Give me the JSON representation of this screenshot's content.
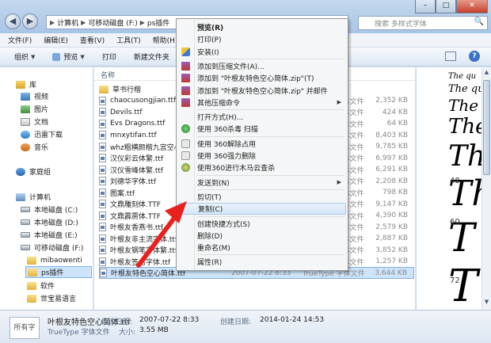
{
  "address": {
    "segments": [
      "计算机",
      "可移动磁盘 (F:)",
      "ps插件"
    ],
    "search_placeholder": "搜索 多样式字体"
  },
  "menubar": [
    "文件(F)",
    "编辑(E)",
    "查看(V)",
    "工具(T)",
    "帮助(H)"
  ],
  "toolbar": {
    "organize": "组织",
    "preview": "预览",
    "print": "打印",
    "new_folder": "新建文件夹"
  },
  "sidebar": {
    "library": "库",
    "video": "视频",
    "pictures": "图片",
    "documents": "文档",
    "thunder": "迅雷下载",
    "music": "音乐",
    "homegroup": "家庭组",
    "computer": "计算机",
    "drive_c": "本地磁盘 (C:)",
    "drive_d": "本地磁盘 (D:)",
    "drive_e": "本地磁盘 (E:)",
    "drive_f": "可移动磁盘 (F:)",
    "folder_mibao": "mibaowenti",
    "folder_ps": "ps插件",
    "folder_software": "软件",
    "folder_shibao": "世宝易语言"
  },
  "filelist": {
    "col_name": "名称",
    "rows": [
      {
        "name": "草书行楷",
        "date": "",
        "type": "",
        "size": ""
      },
      {
        "name": "chaocusongjian.ttf",
        "date": "",
        "type": "TrueType 字体文件",
        "size": "2,352 KB"
      },
      {
        "name": "Devils.ttf",
        "date": "",
        "type": "TrueType 字体文件",
        "size": "424 KB"
      },
      {
        "name": "Evs Dragons.ttf",
        "date": "",
        "type": "TrueType 字体文件",
        "size": "64 KB"
      },
      {
        "name": "mnxytifan.ttf",
        "date": "",
        "type": "TrueType 字体文件",
        "size": "8,403 KB"
      },
      {
        "name": "whz粗横颜楷九宫空心.ttf",
        "date": "",
        "type": "TrueType 字体文件",
        "size": "9,785 KB"
      },
      {
        "name": "汉仪彩云体繁.ttf",
        "date": "",
        "type": "TrueType 字体文件",
        "size": "6,997 KB"
      },
      {
        "name": "汉仪雪峰体繁.ttf",
        "date": "",
        "type": "TrueType 字体文件",
        "size": "6,291 KB"
      },
      {
        "name": "刘德华字体.ttf",
        "date": "",
        "type": "TrueType 字体文件",
        "size": "2,208 KB"
      },
      {
        "name": "图案.ttf",
        "date": "",
        "type": "TrueType 字体文件",
        "size": "798 KB"
      },
      {
        "name": "文鼎雕刻体.TTF",
        "date": "",
        "type": "TrueType 字体文件",
        "size": "9,147 KB"
      },
      {
        "name": "文鼎霹雳体.TTF",
        "date": "",
        "type": "TrueType 字体文件",
        "size": "4,390 KB"
      },
      {
        "name": "叶根友香燕书.ttf",
        "date": "",
        "type": "TrueType 字体文件",
        "size": "2,579 KB"
      },
      {
        "name": "叶根友非主流字体.ttf",
        "date": "",
        "type": "TrueType 字体文件",
        "size": "2,887 KB"
      },
      {
        "name": "叶根友钢笔字体繁.ttf",
        "date": "",
        "type": "TrueType 字体文件",
        "size": "3,852 KB"
      },
      {
        "name": "叶根友签名字体.ttf",
        "date": "",
        "type": "TrueType 字体文件",
        "size": "1,257 KB"
      },
      {
        "name": "叶根友特色空心简体.ttf",
        "date": "2007-07-22 8:33",
        "type": "TrueType 字体文件",
        "size": "3,644 KB"
      }
    ]
  },
  "preview": {
    "lines": [
      "The qu",
      "The qu",
      "The",
      "The",
      "Th",
      "Th",
      "T",
      "T"
    ],
    "numbers": [
      "48",
      "60",
      "72"
    ]
  },
  "context_menu": {
    "items": [
      {
        "label": "预览(R)",
        "bold": true
      },
      {
        "label": "打印(P)"
      },
      {
        "label": "安装(I)"
      },
      {
        "label": "添加到压缩文件(A)..."
      },
      {
        "label": "添加到 \"叶根友特色空心简体.zip\"(T)"
      },
      {
        "label": "添加到 \"叶根友特色空心简体.zip\" 并邮件"
      },
      {
        "label": "其他压缩命令",
        "submenu": true
      },
      {
        "label": "打开方式(H)..."
      },
      {
        "label": "使用 360杀毒 扫描"
      },
      {
        "label": "使用 360解除占用"
      },
      {
        "label": "使用 360强力删除"
      },
      {
        "label": "使用360进行木马云查杀"
      },
      {
        "label": "发送到(N)",
        "submenu": true
      },
      {
        "label": "剪切(T)"
      },
      {
        "label": "复制(C)",
        "highlighted": true
      },
      {
        "label": "创建快捷方式(S)"
      },
      {
        "label": "删除(D)"
      },
      {
        "label": "重命名(M)"
      },
      {
        "label": "属性(R)"
      }
    ]
  },
  "details": {
    "thumb_text": "所有字",
    "filename": "叶根友特色空心简体.ttf",
    "type": "TrueType 字体文件",
    "modified_label": "修改日期:",
    "modified_value": "2007-07-22 8:33",
    "size_label": "大小:",
    "size_value": "3.55 MB",
    "created_label": "创建日期:",
    "created_value": "2014-01-24 14:53"
  },
  "colors": {
    "selection": "#cde4fb",
    "menu_highlight": "#d6e7fa",
    "arrow": "#e8211d"
  }
}
